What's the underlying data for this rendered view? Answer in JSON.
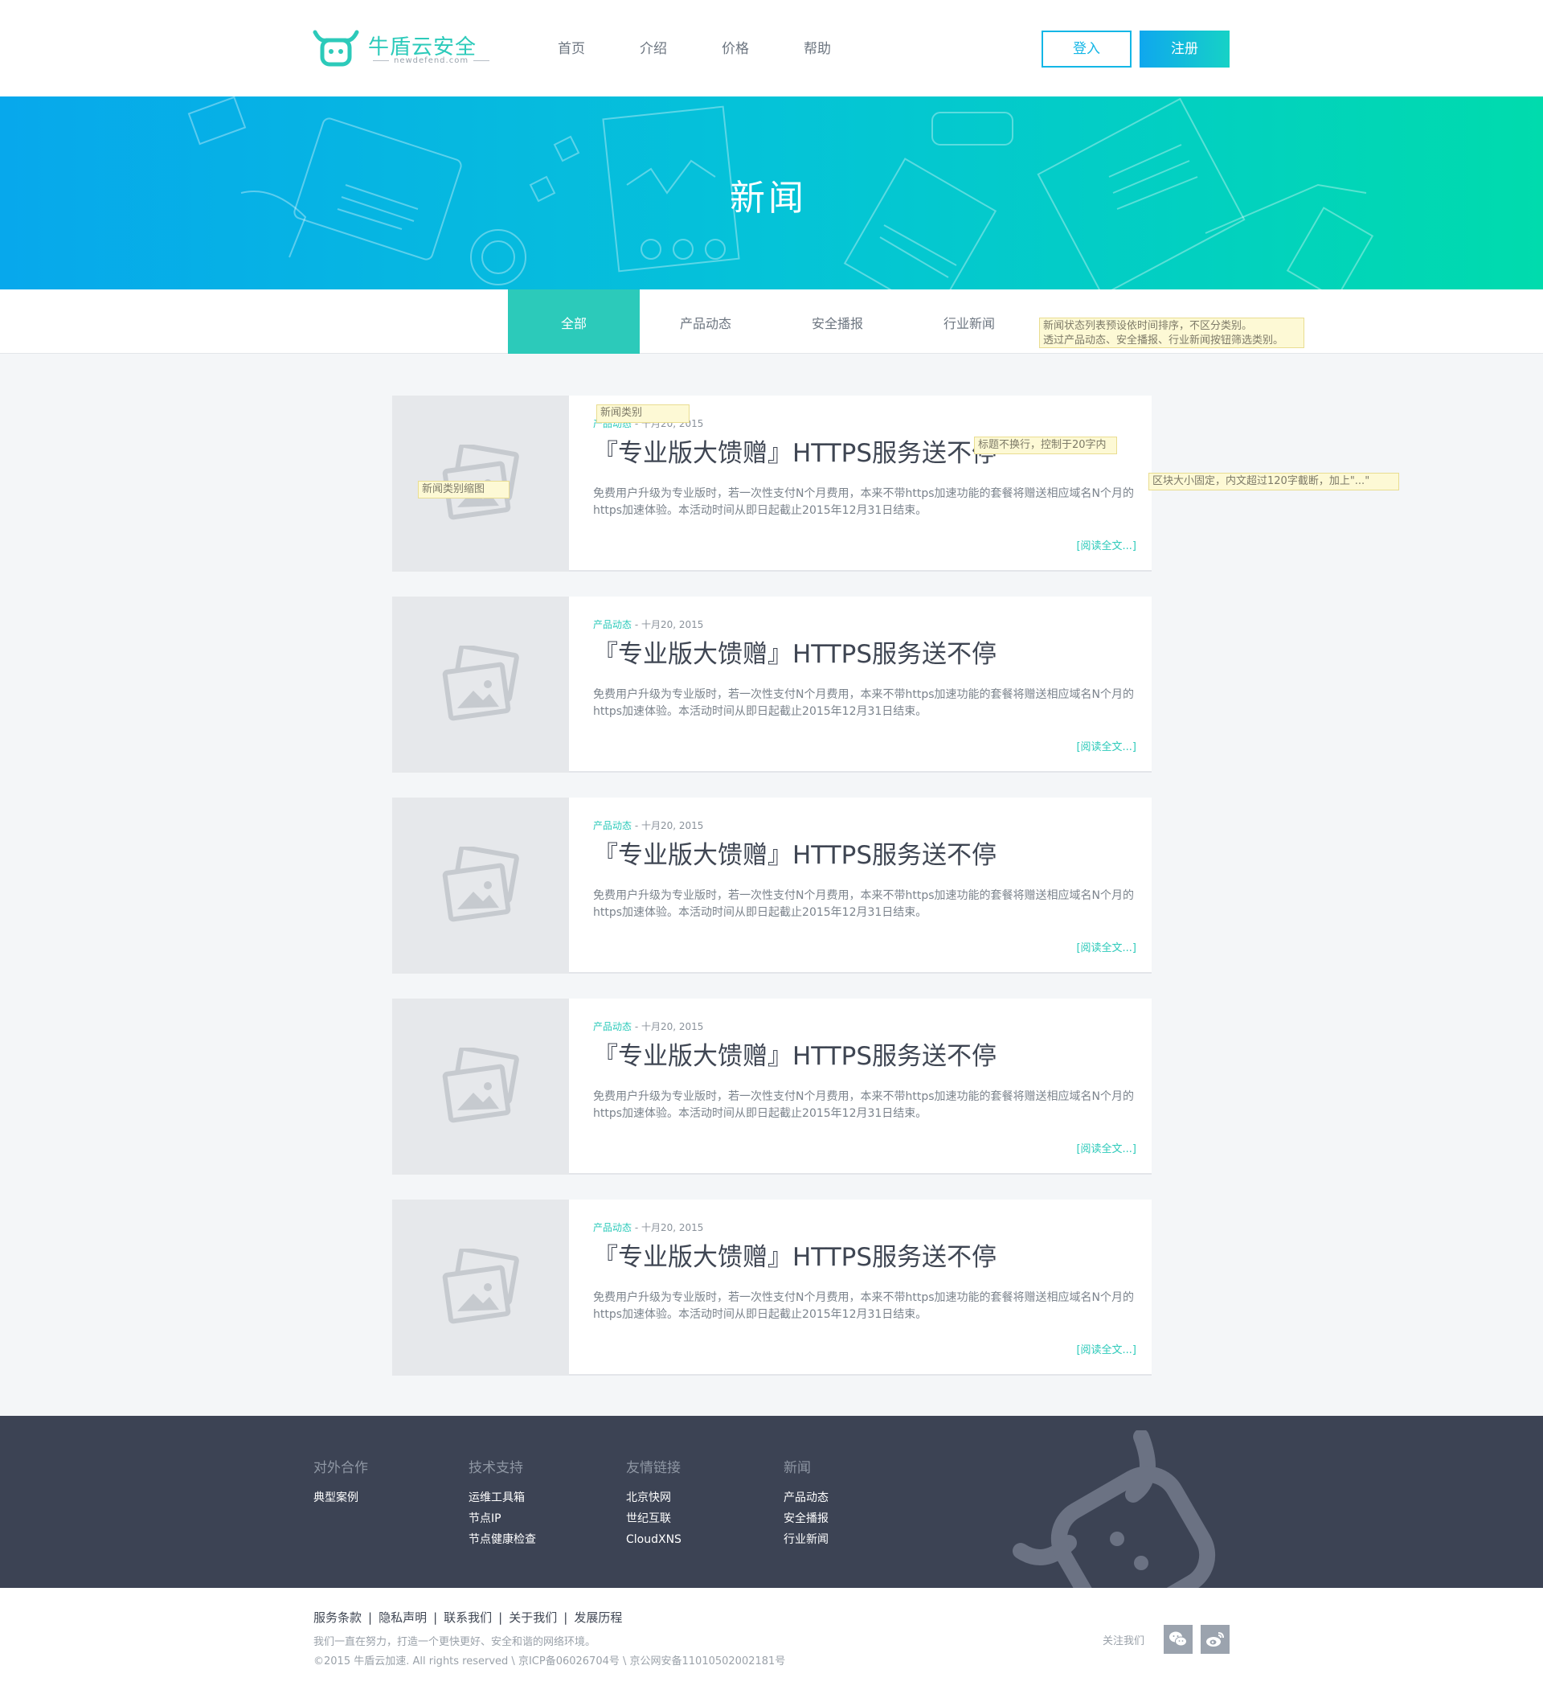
{
  "header": {
    "logo_text": "牛盾云安全",
    "logo_domain": "newdefend.com",
    "nav": [
      "首页",
      "介绍",
      "价格",
      "帮助"
    ],
    "login_label": "登入",
    "register_label": "注册"
  },
  "banner": {
    "title": "新闻"
  },
  "tabs": [
    "全部",
    "产品动态",
    "安全播报",
    "行业新闻"
  ],
  "notes": {
    "tabs_note_line1": "新闻状态列表预设依时间排序，不区分类别。",
    "tabs_note_line2": "透过产品动态、安全播报、行业新闻按钮筛选类别。",
    "category_note": "新闻类别",
    "title_note": "标题不换行，控制于20字内",
    "desc_note": "区块大小固定，内文超过120字截断，加上\"...\"",
    "thumb_note": "新闻类别缩图"
  },
  "news": [
    {
      "category": "产品动态",
      "date": " - 十月20, 2015",
      "title": "『专业版大馈赠』HTTPS服务送不停",
      "desc": "免费用户升级为专业版时，若一次性支付N个月费用，本来不带https加速功能的套餐将赠送相应域名N个月的https加速体验。本活动时间从即日起截止2015年12月31日结束。",
      "more": "[阅读全文...]"
    },
    {
      "category": "产品动态",
      "date": " - 十月20, 2015",
      "title": "『专业版大馈赠』HTTPS服务送不停",
      "desc": "免费用户升级为专业版时，若一次性支付N个月费用，本来不带https加速功能的套餐将赠送相应域名N个月的https加速体验。本活动时间从即日起截止2015年12月31日结束。",
      "more": "[阅读全文...]"
    },
    {
      "category": "产品动态",
      "date": " - 十月20, 2015",
      "title": "『专业版大馈赠』HTTPS服务送不停",
      "desc": "免费用户升级为专业版时，若一次性支付N个月费用，本来不带https加速功能的套餐将赠送相应域名N个月的https加速体验。本活动时间从即日起截止2015年12月31日结束。",
      "more": "[阅读全文...]"
    },
    {
      "category": "产品动态",
      "date": " - 十月20, 2015",
      "title": "『专业版大馈赠』HTTPS服务送不停",
      "desc": "免费用户升级为专业版时，若一次性支付N个月费用，本来不带https加速功能的套餐将赠送相应域名N个月的https加速体验。本活动时间从即日起截止2015年12月31日结束。",
      "more": "[阅读全文...]"
    },
    {
      "category": "产品动态",
      "date": " - 十月20, 2015",
      "title": "『专业版大馈赠』HTTPS服务送不停",
      "desc": "免费用户升级为专业版时，若一次性支付N个月费用，本来不带https加速功能的套餐将赠送相应域名N个月的https加速体验。本活动时间从即日起截止2015年12月31日结束。",
      "more": "[阅读全文...]"
    }
  ],
  "footer": {
    "columns": [
      {
        "heading": "对外合作",
        "links": [
          "典型案例"
        ]
      },
      {
        "heading": "技术支持",
        "links": [
          "运维工具箱",
          "节点IP",
          "节点健康检查"
        ]
      },
      {
        "heading": "友情链接",
        "links": [
          "北京快网",
          "世纪互联",
          "CloudXNS"
        ]
      },
      {
        "heading": "新闻",
        "links": [
          "产品动态",
          "安全播报",
          "行业新闻"
        ]
      }
    ]
  },
  "bottom": {
    "links": [
      "服务条款",
      "隐私声明",
      "联系我们",
      "关于我们",
      "发展历程"
    ],
    "slogan": "我们一直在努力，打造一个更快更好、安全和谐的网络环境。",
    "copyright": "©2015 牛盾云加速. All rights reserved \\ 京ICP备06026704号 \\ 京公网安备11010502002181号",
    "follow_label": "关注我们"
  },
  "colors": {
    "accent": "#2ccaba",
    "login_border": "#13b6e6",
    "footer_bg": "#3c4354"
  },
  "icons": [
    "logo-cow-icon",
    "image-placeholder-icon",
    "wechat-icon",
    "weibo-icon"
  ]
}
